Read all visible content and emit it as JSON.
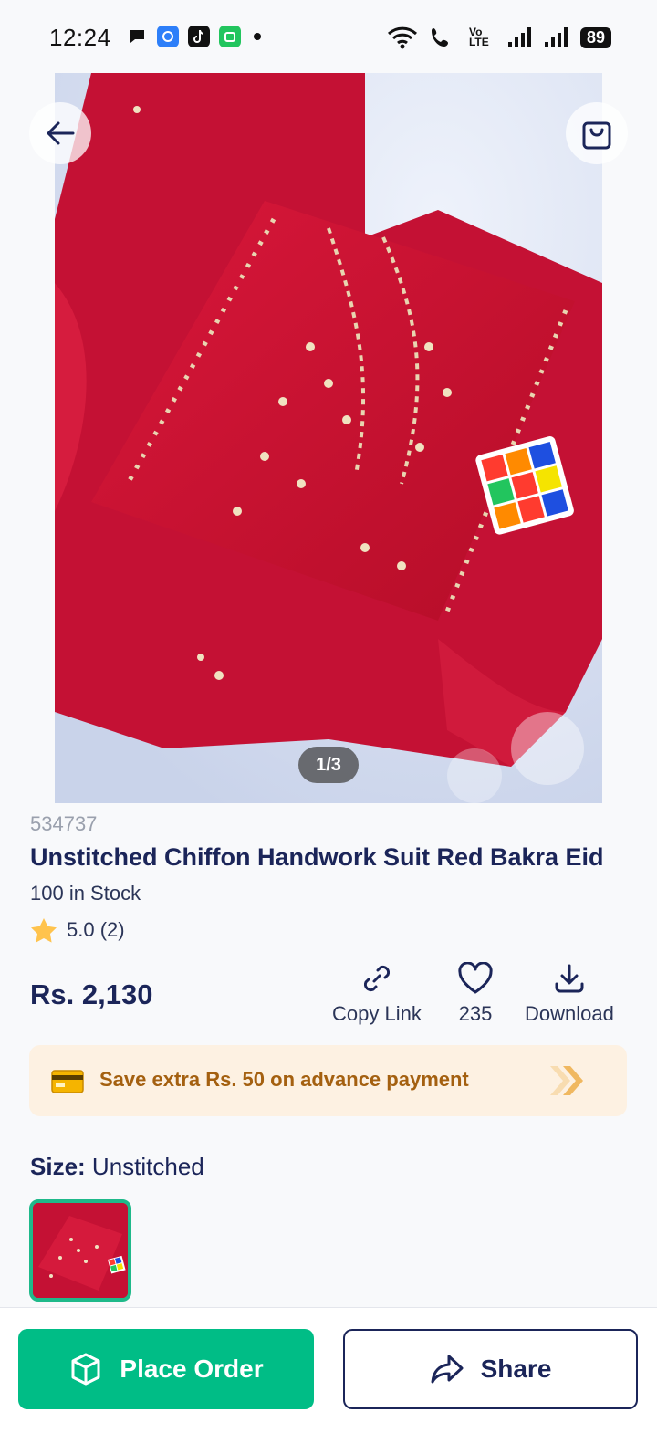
{
  "status_bar": {
    "time": "12:24",
    "battery": "89",
    "volte_label": "Vo LTE"
  },
  "product": {
    "image_pager": "1/3",
    "id": "534737",
    "title": "Unstitched Chiffon Handwork Suit Red Bakra Eid",
    "stock": "100 in Stock",
    "rating": "5.0 (2)",
    "price": "Rs. 2,130"
  },
  "actions": {
    "copy_link": "Copy Link",
    "likes": "235",
    "download": "Download"
  },
  "promo": {
    "text": "Save extra Rs. 50 on advance payment"
  },
  "size": {
    "label": "Size:",
    "value": "Unstitched"
  },
  "bottom": {
    "place_order": "Place Order",
    "share": "Share"
  },
  "colors": {
    "primary_green": "#00bd86",
    "navy": "#1b2559",
    "promo_bg": "#fdf1e2",
    "promo_text": "#a46010",
    "fabric_red": "#c8102e"
  }
}
